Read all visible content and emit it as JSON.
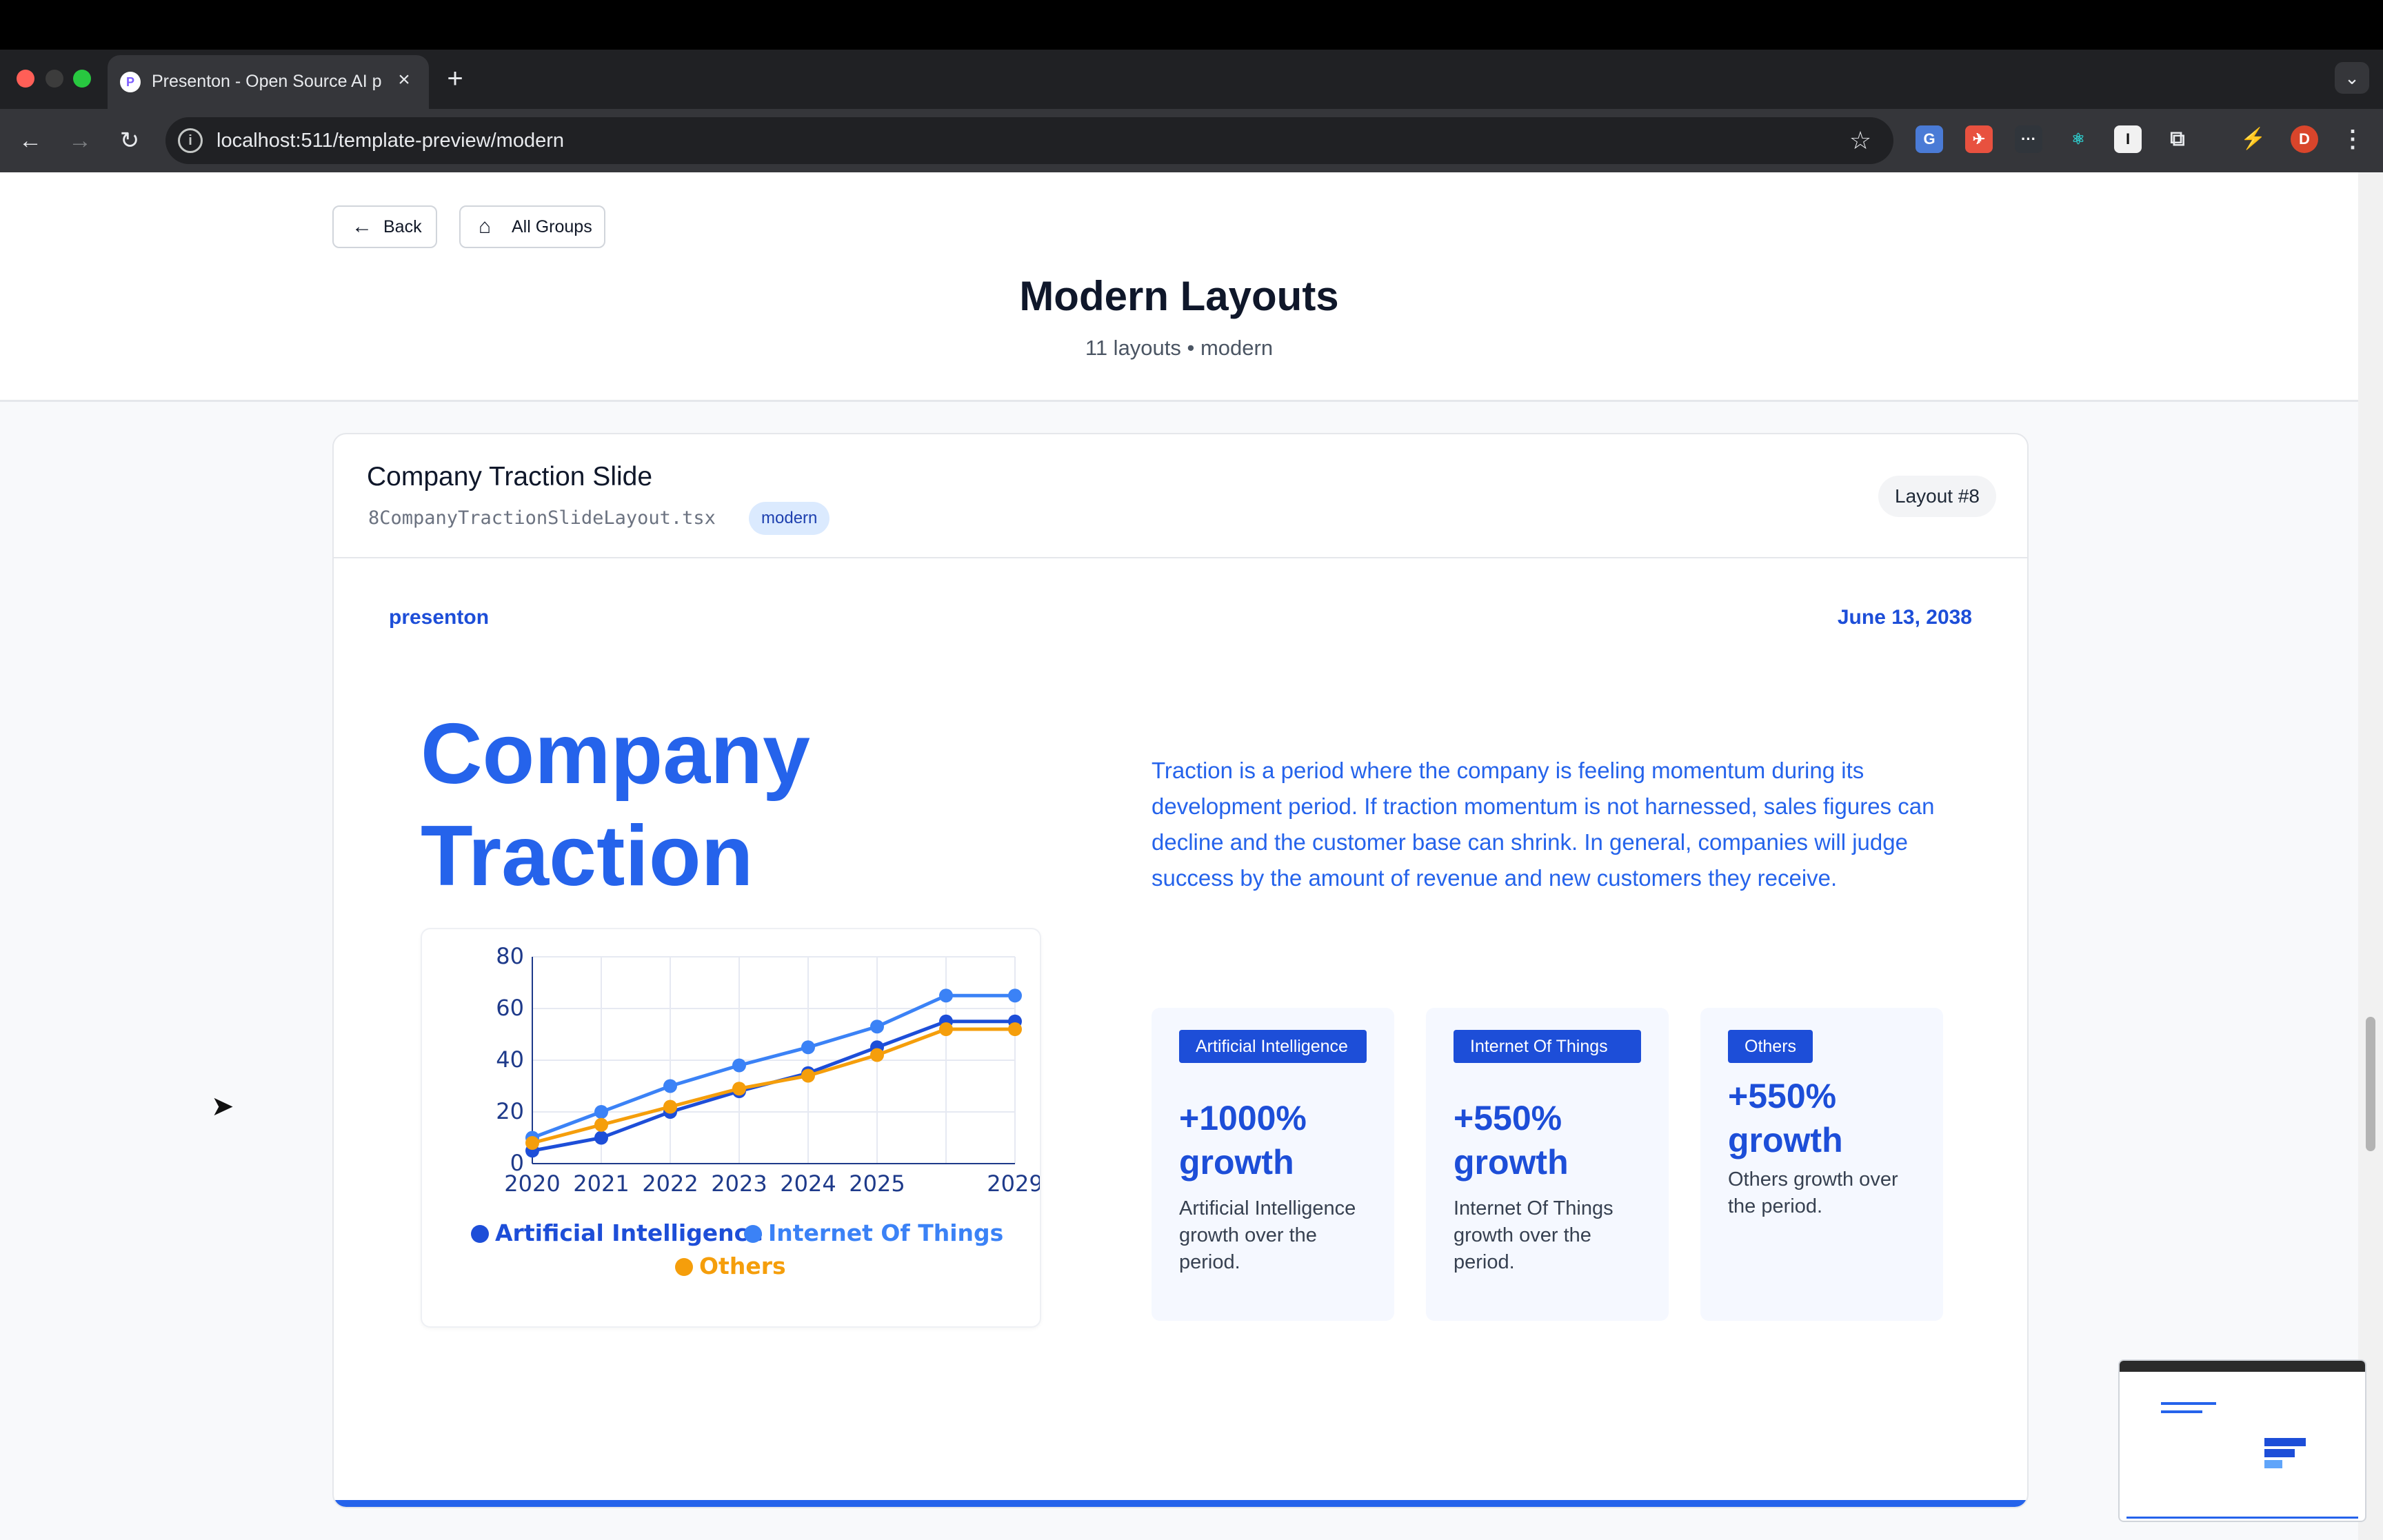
{
  "browser": {
    "tab_title": "Presenton - Open Source AI p",
    "favicon": "P",
    "url": "localhost:511/template-preview/modern",
    "profile_initial": "D"
  },
  "header": {
    "back_label": "Back",
    "all_groups_label": "All Groups",
    "title": "Modern Layouts",
    "subtitle": "11 layouts • modern"
  },
  "card": {
    "title": "Company Traction Slide",
    "file": "8CompanyTractionSlideLayout.tsx",
    "badge": "modern",
    "layout_number": "Layout #8"
  },
  "slide": {
    "brand": "presenton",
    "date": "June 13, 2038",
    "title": "Company Traction",
    "description": "Traction is a period where the company is feeling momentum during its development period. If traction momentum is not harnessed, sales figures can decline and the customer base can shrink. In general, companies will judge success by the amount of revenue and new customers they receive.",
    "stats": [
      {
        "tag": "Artificial Intelligence",
        "value": "+1000% growth",
        "desc": "Artificial Intelligence growth over the period."
      },
      {
        "tag": "Internet Of Things",
        "value": "+550% growth",
        "desc": "Internet Of Things growth over the period."
      },
      {
        "tag": "Others",
        "value": "+550% growth",
        "desc": "Others growth over the period."
      }
    ]
  },
  "chart_data": {
    "type": "line",
    "x": [
      2020,
      2021,
      2022,
      2023,
      2024,
      2025,
      2026,
      2027
    ],
    "x_tick_labels": [
      "2020",
      "2021",
      "2022",
      "2023",
      "2024",
      "2025",
      "2029"
    ],
    "y_ticks": [
      "0",
      "20",
      "40",
      "60",
      "80"
    ],
    "ylim": [
      0,
      80
    ],
    "grid": true,
    "legend": "bottom",
    "series": [
      {
        "name": "Artificial Intelligence",
        "color": "#1d4ed8",
        "values": [
          5,
          10,
          20,
          28,
          35,
          45,
          55,
          55
        ]
      },
      {
        "name": "Internet Of Things",
        "color": "#3b82f6",
        "values": [
          10,
          20,
          30,
          38,
          45,
          53,
          65,
          65
        ]
      },
      {
        "name": "Others",
        "color": "#f59e0b",
        "values": [
          8,
          15,
          22,
          29,
          34,
          42,
          52,
          52
        ]
      }
    ]
  }
}
